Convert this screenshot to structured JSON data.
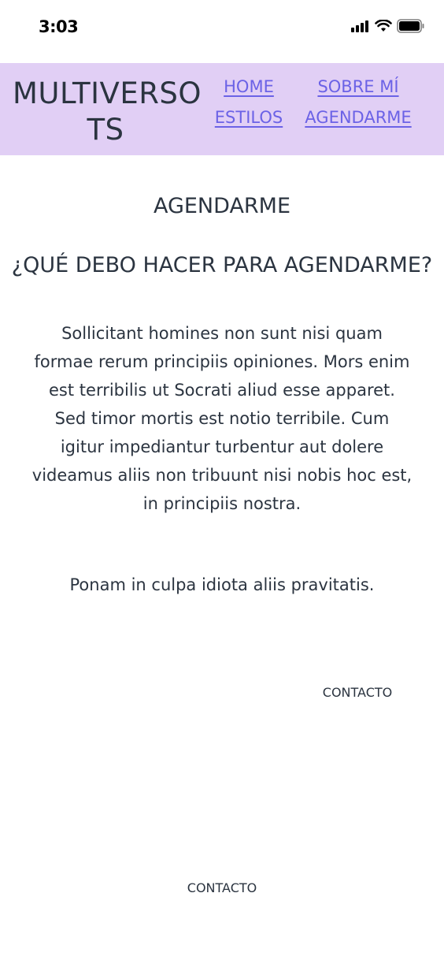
{
  "status": {
    "time": "3:03"
  },
  "header": {
    "brand": "MULTIVERSO TS",
    "nav": [
      {
        "label": "HOME"
      },
      {
        "label": "SOBRE MÍ"
      },
      {
        "label": "ESTILOS"
      },
      {
        "label": "AGENDARME"
      }
    ]
  },
  "main": {
    "title": "AGENDARME",
    "question": "¿QUÉ DEBO HACER PARA AGENDARME?",
    "paragraph": "Sollicitant homines non sunt nisi quam formae rerum principiis opiniones. Mors enim est terribilis ut Socrati aliud esse apparet. Sed timor mortis est notio terribile. Cum igitur impediantur turbentur aut dolere videamus aliis non tribuunt nisi nobis hoc est, in principiis nostra.",
    "paragraph2": "Ponam in culpa idiota aliis pravitatis."
  },
  "contact": {
    "label_right": "CONTACTO",
    "label_footer": "CONTACTO"
  }
}
